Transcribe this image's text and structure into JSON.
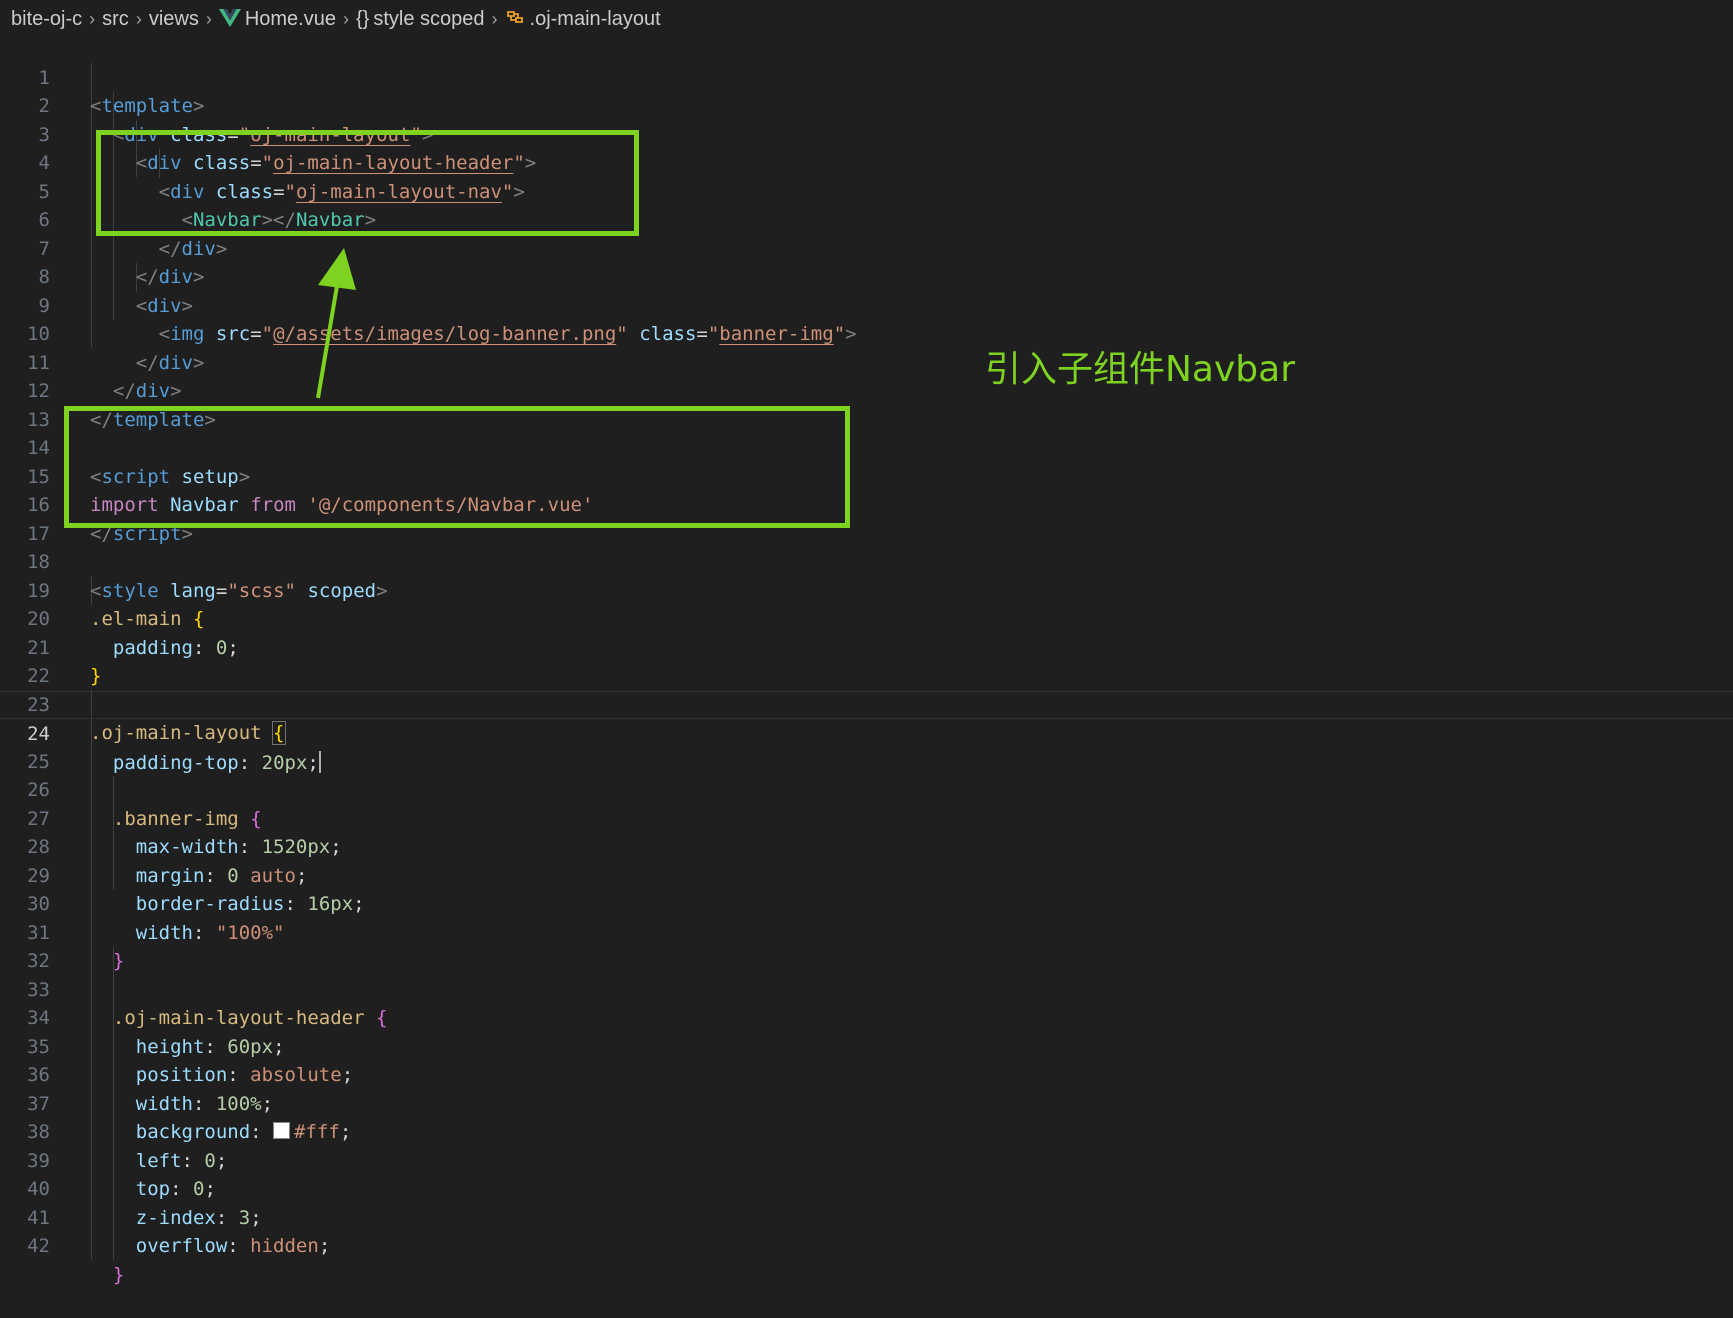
{
  "breadcrumb": {
    "items": [
      "bite-oj-c",
      "src",
      "views",
      "Home.vue",
      "style scoped",
      ".oj-main-layout"
    ],
    "icons": [
      "vue-file-icon",
      "braces-icon",
      "symbol-class-icon"
    ]
  },
  "editor": {
    "current_line": 24,
    "lines": [
      {
        "n": "1"
      },
      {
        "n": "2"
      },
      {
        "n": "3"
      },
      {
        "n": "4"
      },
      {
        "n": "5"
      },
      {
        "n": "6"
      },
      {
        "n": "7"
      },
      {
        "n": "8"
      },
      {
        "n": "9"
      },
      {
        "n": "10"
      },
      {
        "n": "11"
      },
      {
        "n": "12"
      },
      {
        "n": "13"
      },
      {
        "n": "14"
      },
      {
        "n": "15"
      },
      {
        "n": "16"
      },
      {
        "n": "17"
      },
      {
        "n": "18"
      },
      {
        "n": "19"
      },
      {
        "n": "20"
      },
      {
        "n": "21"
      },
      {
        "n": "22"
      },
      {
        "n": "23"
      },
      {
        "n": "24"
      },
      {
        "n": "25"
      },
      {
        "n": "26"
      },
      {
        "n": "27"
      },
      {
        "n": "28"
      },
      {
        "n": "29"
      },
      {
        "n": "30"
      },
      {
        "n": "31"
      },
      {
        "n": "32"
      },
      {
        "n": "33"
      },
      {
        "n": "34"
      },
      {
        "n": "35"
      },
      {
        "n": "36"
      },
      {
        "n": "37"
      },
      {
        "n": "38"
      },
      {
        "n": "39"
      },
      {
        "n": "40"
      },
      {
        "n": "41"
      },
      {
        "n": "42"
      }
    ],
    "tokens": {
      "template": "template",
      "div": "div",
      "class": "class",
      "cls_main": "oj-main-layout",
      "cls_header": "oj-main-layout-header",
      "cls_nav": "oj-main-layout-nav",
      "navbar": "Navbar",
      "img": "img",
      "src": "src",
      "img_src": "@/assets/images/log-banner.png",
      "cls_banner": "banner-img",
      "script": "script",
      "setup": "setup",
      "import": "import",
      "from": "from",
      "import_path": "'@/components/Navbar.vue'",
      "style": "style",
      "lang": "lang",
      "scss": "scss",
      "scoped": "scoped",
      "sel_el_main": ".el-main",
      "sel_main_layout": ".oj-main-layout",
      "sel_banner": ".banner-img",
      "sel_header": ".oj-main-layout-header",
      "p_padding": "padding",
      "p_padding_top": "padding-top",
      "p_max_width": "max-width",
      "p_margin": "margin",
      "p_border_radius": "border-radius",
      "p_width": "width",
      "p_height": "height",
      "p_position": "position",
      "p_background": "background",
      "p_left": "left",
      "p_top": "top",
      "p_z_index": "z-index",
      "p_overflow": "overflow",
      "v_0": "0",
      "v_20px": "20px",
      "v_1520px": "1520px",
      "v_auto": "auto",
      "v_16px": "16px",
      "v_100pct_str": "\"100%\"",
      "v_60px": "60px",
      "v_absolute": "absolute",
      "v_100pct": "100%",
      "v_fff": "#fff",
      "v_3": "3",
      "v_hidden": "hidden"
    }
  },
  "annotation": {
    "text": "引入子组件Navbar",
    "color": "#7ed321"
  },
  "colors": {
    "background": "#1f1f1f",
    "highlight": "#7ed321"
  }
}
